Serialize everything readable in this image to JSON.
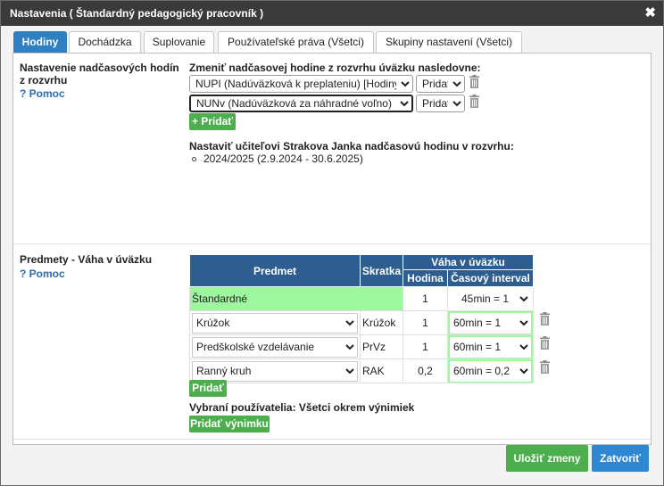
{
  "title": "Nastavenia ( Štandardný pedagogický pracovník )",
  "tabs": [
    {
      "label": "Hodiny"
    },
    {
      "label": "Dochádzka"
    },
    {
      "label": "Suplovanie"
    },
    {
      "label": "Používateľské práva (Všetci)"
    },
    {
      "label": "Skupiny nastavení (Všetci)"
    }
  ],
  "overtime": {
    "label_line1": "Nastavenie nadčasových hodín",
    "label_line2": "z rozvrhu",
    "help": "? Pomoc",
    "intro": "Zmeniť nadčasovej hodine z rozvrhu úväzku nasledovne:",
    "rules": [
      {
        "type": "NUPI (Nadúväzková k preplateniu) [Hodiny",
        "action": "Pridať"
      },
      {
        "type": "NUNv (Nadúväzková za náhradné voľno) [H",
        "action": "Pridať"
      }
    ],
    "add_button": "+ Pridať",
    "teacher_label": "Nastaviť učiteľovi Strakova Janka nadčasovú hodinu v rozvrhu:",
    "years": [
      "2024/2025 (2.9.2024 - 30.6.2025)"
    ]
  },
  "subjects": {
    "label": "Predmety - Váha v úväzku",
    "help": "? Pomoc",
    "headers": {
      "subject": "Predmet",
      "abbr": "Skratka",
      "weight": "Váha v úväzku",
      "hours": "Hodina",
      "interval": "Časový interval"
    },
    "standard": {
      "name": "Štandardné",
      "hours": "1",
      "interval": "45min = 1"
    },
    "rows": [
      {
        "subject": "Krúžok",
        "abbr": "Krúžok",
        "hours": "1",
        "interval": "60min = 1"
      },
      {
        "subject": "Predškolské vzdelávanie",
        "abbr": "PrVz",
        "hours": "1",
        "interval": "60min = 1"
      },
      {
        "subject": "Ranný kruh",
        "abbr": "RAK",
        "hours": "0,2",
        "interval": "60min = 0,2"
      }
    ],
    "add_button": "Pridať",
    "selected_users": "Vybraní používatelia: Všetci okrem výnimiek",
    "add_exception": "Pridať výnimku"
  },
  "footer": {
    "save": "Uložiť zmeny",
    "close": "Zatvoriť"
  },
  "colors": {
    "titlebar": "#3a3a3a",
    "tab_active": "#2f7fc1",
    "table_header": "#2e5e8f",
    "green_highlight": "#9ef79e",
    "button_green": "#4cae4c",
    "button_blue": "#2f86d1"
  }
}
